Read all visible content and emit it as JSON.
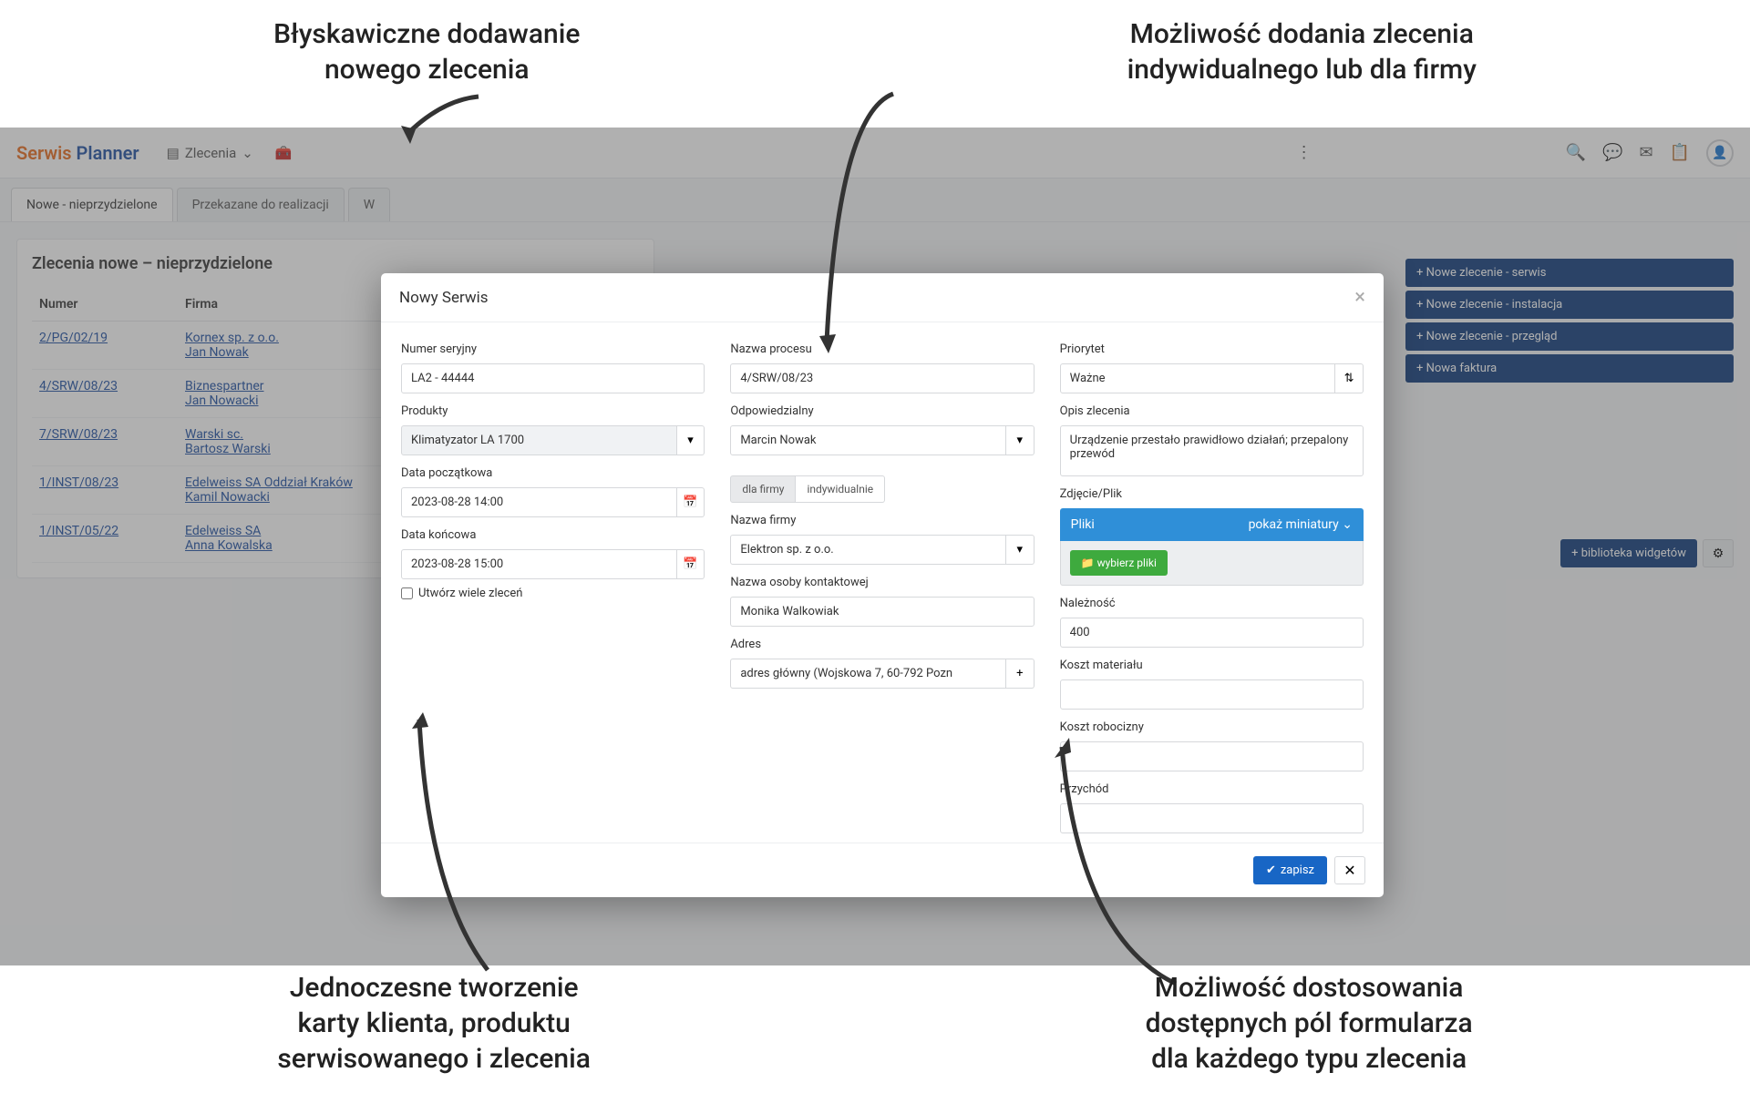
{
  "annotations": {
    "top_left": "Błyskawiczne dodawanie\nnowego zlecenia",
    "top_right": "Możliwość dodania zlecenia\nindywidualnego lub dla firmy",
    "bottom_left": "Jednoczesne tworzenie\nkarty klienta, produktu\nserwisowanego i zlecenia",
    "bottom_right": "Możliwość dostosowania\ndostępnych pól formularza\ndla każdego typu zlecenia"
  },
  "app": {
    "logo1": "Serwis",
    "logo2": " Planner",
    "nav": {
      "zlecenia": "Zlecenia"
    }
  },
  "tabs": {
    "t1": "Nowe - nieprzydzielone",
    "t2": "Przekazane do realizacji",
    "t3": "W"
  },
  "panel": {
    "title": "Zlecenia nowe – nieprzydzielone",
    "col_number": "Numer",
    "col_company": "Firma"
  },
  "rows": [
    {
      "num": "2/PG/02/19",
      "c1": "Kornex sp. z o.o.",
      "c2": "Jan Nowak"
    },
    {
      "num": "4/SRW/08/23",
      "c1": "Biznespartner",
      "c2": "Jan Nowacki"
    },
    {
      "num": "7/SRW/08/23",
      "c1": "Warski sc.",
      "c2": "Bartosz Warski"
    },
    {
      "num": "1/INST/08/23",
      "c1": "Edelweiss SA Oddział Kraków",
      "c2": "Kamil Nowacki"
    },
    {
      "num": "1/INST/05/22",
      "c1": "Edelweiss SA",
      "c2": "Anna Kowalska"
    }
  ],
  "actions": {
    "a1": "+ Nowe zlecenie - serwis",
    "a2": "+ Nowe zlecenie - instalacja",
    "a3": "+ Nowe zlecenie - przegląd",
    "a4": "+ Nowa faktura",
    "widgets": "+ biblioteka widgetów"
  },
  "modal": {
    "title": "Nowy Serwis",
    "labels": {
      "serial": "Numer seryjny",
      "products": "Produkty",
      "date_start": "Data początkowa",
      "date_end": "Data końcowa",
      "multi": "Utwórz wiele zleceń",
      "process": "Nazwa procesu",
      "responsible": "Odpowiedzialny",
      "for_company": "dla firmy",
      "individually": "indywidualnie",
      "company_name": "Nazwa firmy",
      "contact_name": "Nazwa osoby kontaktowej",
      "address": "Adres",
      "priority": "Priorytet",
      "description": "Opis zlecenia",
      "file": "Zdjęcie/Plik",
      "files_header": "Pliki",
      "files_thumbs": "pokaż miniatury",
      "pick_files": "wybierz pliki",
      "due": "Należność",
      "material_cost": "Koszt materiału",
      "labor_cost": "Koszt robocizny",
      "revenue": "Przychód",
      "save": "zapisz"
    },
    "values": {
      "serial": "LA2 - 44444",
      "products": "Klimatyzator LA 1700",
      "date_start": "2023-08-28 14:00",
      "date_end": "2023-08-28 15:00",
      "process": "4/SRW/08/23",
      "responsible": "Marcin Nowak",
      "company_name": "Elektron sp. z o.o.",
      "contact_name": "Monika Walkowiak",
      "address": "adres główny (Wojskowa 7, 60-792 Pozn",
      "priority": "Ważne",
      "description": "Urządzenie przestało prawidłowo działań; przepalony przewód",
      "due": "400",
      "material_cost": "",
      "labor_cost": "",
      "revenue": ""
    }
  }
}
